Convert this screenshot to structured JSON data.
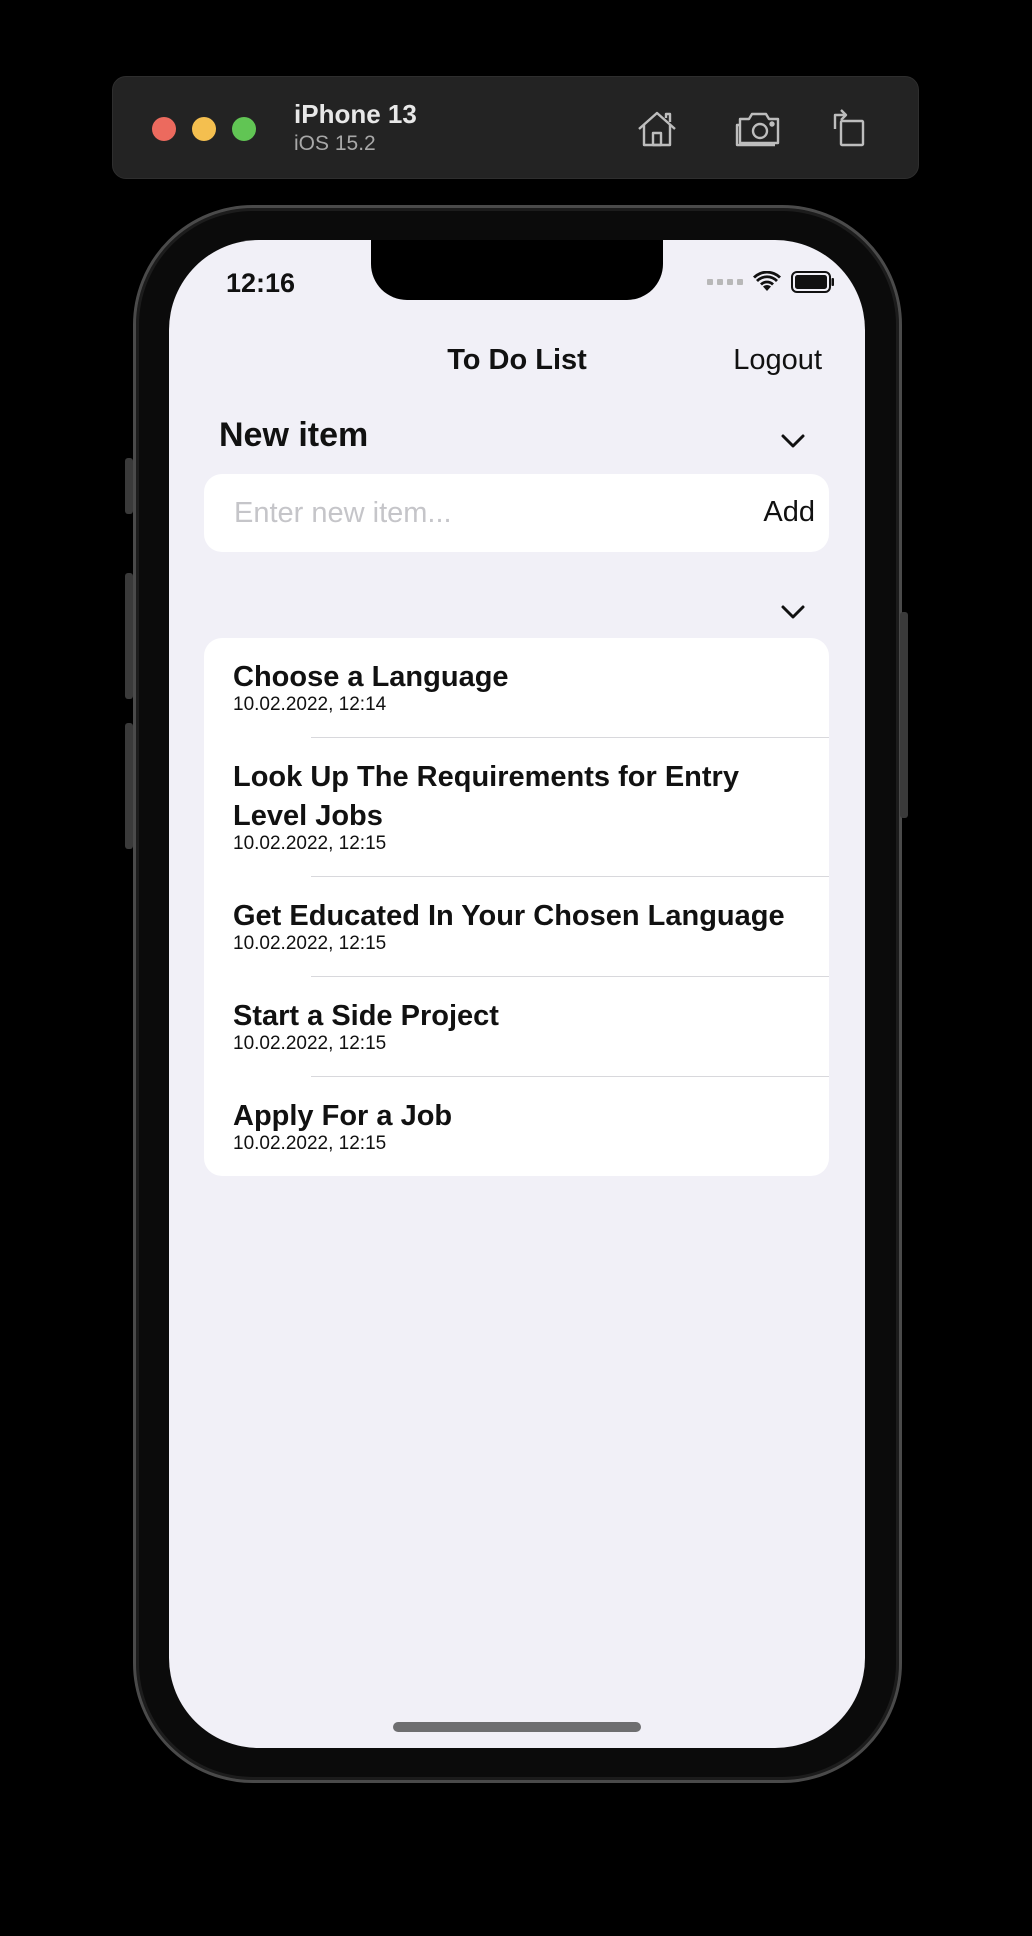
{
  "simulator": {
    "device": "iPhone 13",
    "os": "iOS 15.2",
    "icons": [
      "home-icon",
      "screenshot-icon",
      "rotate-icon"
    ]
  },
  "status_bar": {
    "time": "12:16",
    "icons": [
      "signal-dots-icon",
      "wifi-icon",
      "battery-icon"
    ]
  },
  "nav": {
    "title": "To Do List",
    "logout": "Logout"
  },
  "new_item_section": {
    "header": "New item",
    "placeholder": "Enter new item...",
    "value": "",
    "add_label": "Add"
  },
  "list": {
    "items": [
      {
        "title": "Choose a Language",
        "date": "10.02.2022, 12:14"
      },
      {
        "title": "Look Up The Requirements for Entry Level Jobs",
        "date": "10.02.2022, 12:15"
      },
      {
        "title": "Get Educated In Your Chosen Language",
        "date": "10.02.2022, 12:15"
      },
      {
        "title": "Start a Side Project",
        "date": "10.02.2022, 12:15"
      },
      {
        "title": "Apply For a Job",
        "date": "10.02.2022, 12:15"
      }
    ]
  }
}
